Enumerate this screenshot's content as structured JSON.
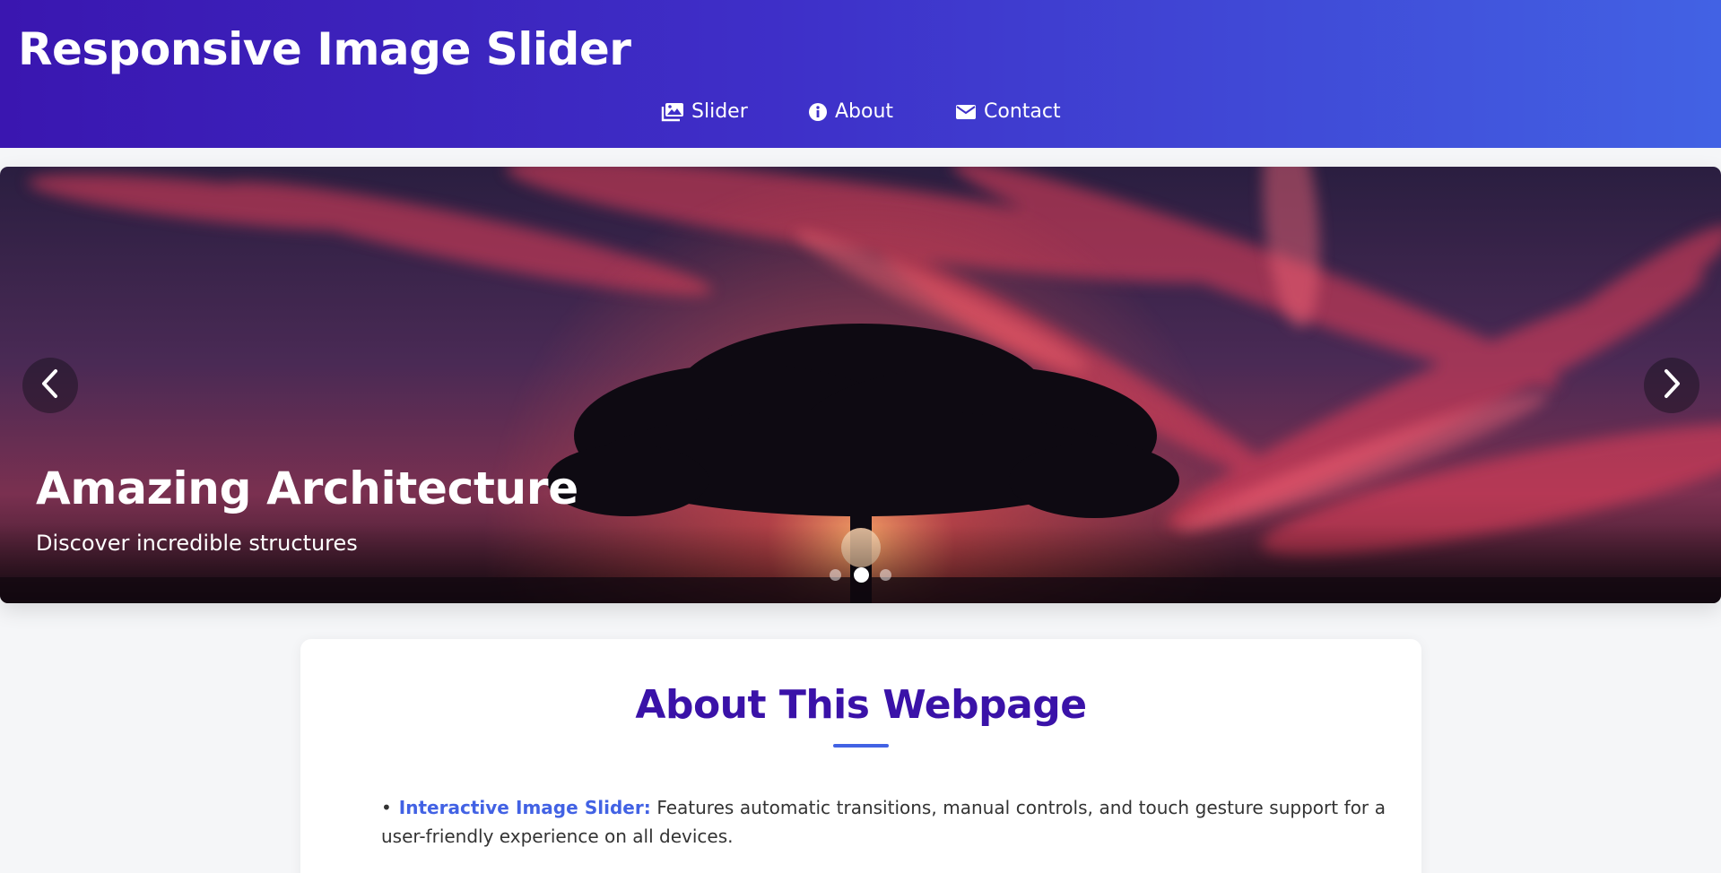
{
  "header": {
    "title": "Responsive Image Slider",
    "background_start": "#3a16b0",
    "background_end": "#4262e4"
  },
  "nav": {
    "items": [
      {
        "label": "Slider",
        "icon": "images-icon"
      },
      {
        "label": "About",
        "icon": "info-circle-icon"
      },
      {
        "label": "Contact",
        "icon": "envelope-icon"
      }
    ]
  },
  "slider": {
    "title": "Amazing Architecture",
    "subtitle": "Discover incredible structures",
    "prev_icon": "chevron-left-icon",
    "next_icon": "chevron-right-icon",
    "slide_count": 3,
    "active_index": 2
  },
  "about": {
    "title": "About This Webpage",
    "accent_color": "#3a12a8",
    "features": [
      {
        "label": "Interactive Image Slider:",
        "text": " Features automatic transitions, manual controls, and touch gesture support for a user-friendly experience on all devices."
      }
    ]
  }
}
